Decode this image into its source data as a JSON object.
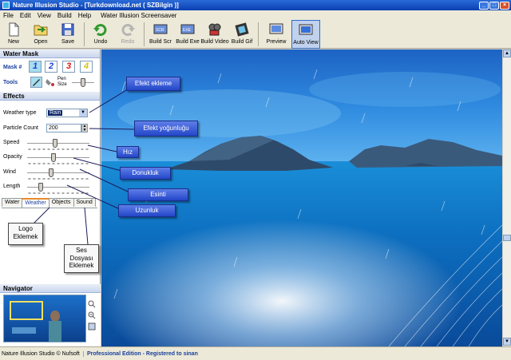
{
  "window": {
    "title": "Nature Illusion Studio - [Turkdownload.net ( SZBilgin )]",
    "buttons": [
      "_",
      "□",
      "×"
    ]
  },
  "menu": [
    "File",
    "Edit",
    "View",
    "Build",
    "Help",
    "Water Illusion Screensaver"
  ],
  "toolbar": [
    {
      "label": "New",
      "icon": "new-icon"
    },
    {
      "label": "Open",
      "icon": "open-icon"
    },
    {
      "label": "Save",
      "icon": "save-icon"
    },
    {
      "label": "Undo",
      "icon": "undo-icon"
    },
    {
      "label": "Redo",
      "icon": "redo-icon",
      "disabled": true
    },
    {
      "label": "Build Scr",
      "icon": "build-scr-icon"
    },
    {
      "label": "Build Exe",
      "icon": "build-exe-icon"
    },
    {
      "label": "Build Video",
      "icon": "build-video-icon"
    },
    {
      "label": "Build Gif",
      "icon": "build-gif-icon"
    },
    {
      "label": "Preview",
      "icon": "preview-icon"
    },
    {
      "label": "Auto View",
      "icon": "auto-view-icon",
      "active": true
    }
  ],
  "water_mask": {
    "header": "Water Mask",
    "mask_label": "Mask #",
    "masks": [
      "1",
      "2",
      "3",
      "4"
    ],
    "mask_colors": [
      "#1a3fd9",
      "#1a3fd9",
      "#d81a1a",
      "#d8c21a"
    ],
    "tools_label": "Tools",
    "pen_size_label": "Pen Size",
    "pen_size": 0.5
  },
  "effects": {
    "header": "Effects",
    "weather_type_label": "Weather type",
    "weather_type": "Rain",
    "particle_count_label": "Particle Count",
    "particle_count": "200",
    "sliders": [
      {
        "label": "Speed",
        "value": 0.45
      },
      {
        "label": "Opacity",
        "value": 0.42
      },
      {
        "label": "Wind",
        "value": 0.38
      },
      {
        "label": "Length",
        "value": 0.2
      }
    ],
    "tabs": [
      "Water",
      "Weather",
      "Objects",
      "Sound"
    ],
    "active_tab": "Weather"
  },
  "navigator": {
    "header": "Navigator"
  },
  "status": {
    "left": "Nature Illusion Studio © Nufsoft",
    "right": "Professional Edition - Registered to sinan"
  },
  "annotations": {
    "efekt_ekleme": "Efekt ekleme",
    "efekt_yogunlugu": "Efekt yoğunluğu",
    "hiz": "Hız",
    "donukluk": "Donukluk",
    "esinti": "Esinti",
    "uzunluk": "Uzunluk",
    "logo": "Logo Eklemek",
    "ses": "Ses Dosyası Eklemek"
  }
}
